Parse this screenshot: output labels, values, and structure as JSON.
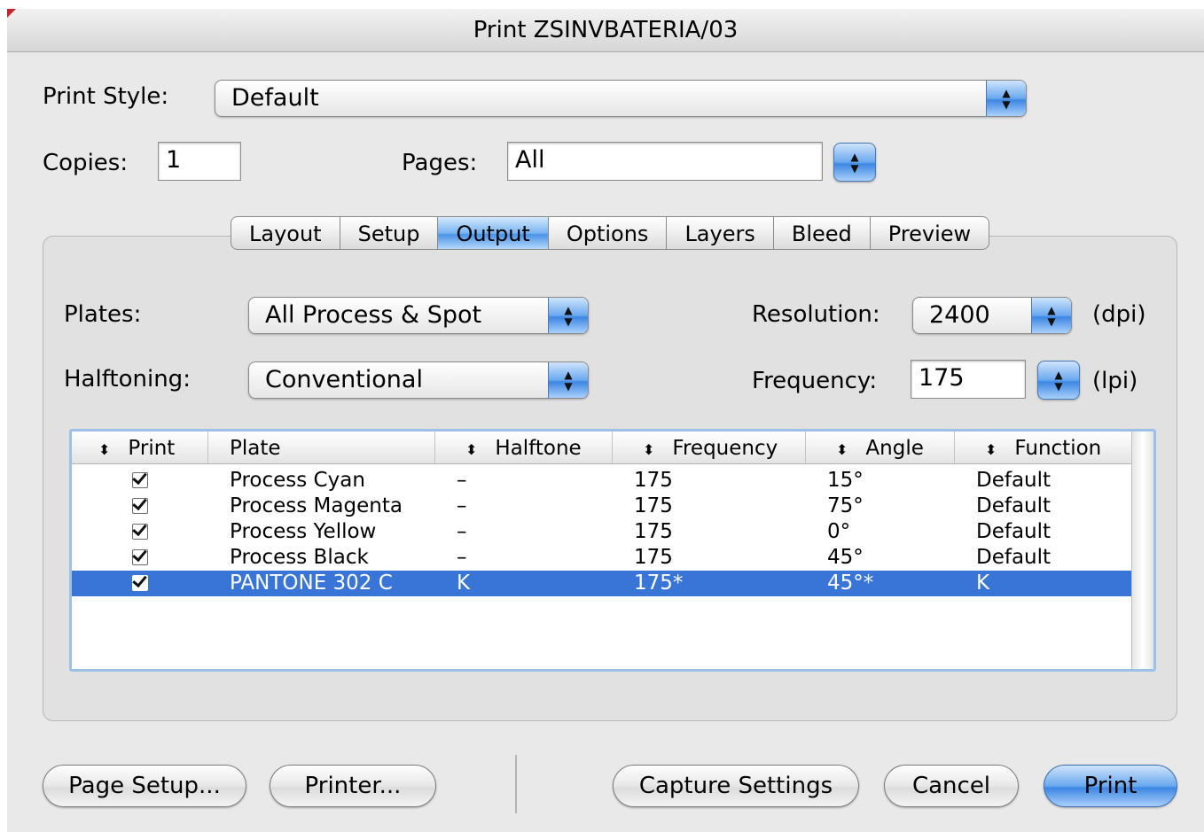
{
  "window": {
    "title": "Print ZSINVBATERIA/03"
  },
  "print_style": {
    "label": "Print Style:",
    "value": "Default"
  },
  "copies": {
    "label": "Copies:",
    "value": "1"
  },
  "pages": {
    "label": "Pages:",
    "value": "All"
  },
  "tabs": [
    {
      "label": "Layout",
      "active": false
    },
    {
      "label": "Setup",
      "active": false
    },
    {
      "label": "Output",
      "active": true
    },
    {
      "label": "Options",
      "active": false
    },
    {
      "label": "Layers",
      "active": false
    },
    {
      "label": "Bleed",
      "active": false
    },
    {
      "label": "Preview",
      "active": false
    }
  ],
  "output": {
    "plates": {
      "label": "Plates:",
      "value": "All Process & Spot"
    },
    "halftoning": {
      "label": "Halftoning:",
      "value": "Conventional"
    },
    "resolution": {
      "label": "Resolution:",
      "value": "2400",
      "unit": "(dpi)"
    },
    "frequency": {
      "label": "Frequency:",
      "value": "175",
      "unit": "(lpi)"
    }
  },
  "table": {
    "columns": [
      "Print",
      "Plate",
      "Halftone",
      "Frequency",
      "Angle",
      "Function"
    ],
    "rows": [
      {
        "print": true,
        "plate": "Process Cyan",
        "halftone": "–",
        "frequency": "175",
        "angle": "15°",
        "function": "Default",
        "selected": false
      },
      {
        "print": true,
        "plate": "Process Magenta",
        "halftone": "–",
        "frequency": "175",
        "angle": "75°",
        "function": "Default",
        "selected": false
      },
      {
        "print": true,
        "plate": "Process Yellow",
        "halftone": "–",
        "frequency": "175",
        "angle": "0°",
        "function": "Default",
        "selected": false
      },
      {
        "print": true,
        "plate": "Process Black",
        "halftone": "–",
        "frequency": "175",
        "angle": "45°",
        "function": "Default",
        "selected": false
      },
      {
        "print": true,
        "plate": "PANTONE 302 C",
        "halftone": "K",
        "frequency": "175*",
        "angle": "45°*",
        "function": "K",
        "selected": true
      }
    ]
  },
  "buttons": {
    "page_setup": "Page Setup...",
    "printer": "Printer...",
    "capture_settings": "Capture Settings",
    "cancel": "Cancel",
    "print": "Print"
  },
  "colors": {
    "accent": "#3875d7",
    "window_bg": "#e9e9e9"
  }
}
